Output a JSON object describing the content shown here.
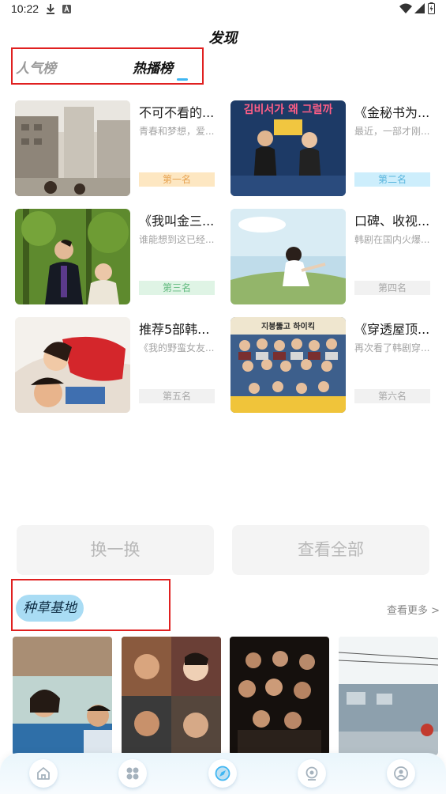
{
  "status_bar": {
    "time": "10:22"
  },
  "header": {
    "title": "发现"
  },
  "tabs": [
    {
      "label": "人气榜",
      "active": false
    },
    {
      "label": "热播榜",
      "active": true
    }
  ],
  "ranking": [
    {
      "title": "不可不看的...",
      "desc": "青春和梦想，爱...",
      "badge": "第一名"
    },
    {
      "title": "《金秘书为...",
      "desc": "最近，一部才刚...",
      "badge": "第二名"
    },
    {
      "title": "《我叫金三...",
      "desc": "谁能想到这已经...",
      "badge": "第三名"
    },
    {
      "title": "口碑、收视...",
      "desc": "韩剧在国内火爆...",
      "badge": "第四名"
    },
    {
      "title": "推荐5部韩...",
      "desc": "《我的野蛮女友...",
      "badge": "第五名"
    },
    {
      "title": "《穿透屋顶...",
      "desc": "再次看了韩剧穿...",
      "badge": "第六名"
    }
  ],
  "poster_texts": {
    "kdrama": "김비서가 왜 그럴까",
    "family": "지붕뚫고 하이킥"
  },
  "actions": {
    "refresh": "换一换",
    "view_all": "查看全部"
  },
  "section": {
    "title": "种草基地",
    "more": "查看更多 >"
  },
  "bottom_nav": [
    {
      "icon": "home-icon"
    },
    {
      "icon": "category-icon"
    },
    {
      "icon": "discover-icon"
    },
    {
      "icon": "video-icon"
    },
    {
      "icon": "profile-icon"
    }
  ],
  "colors": {
    "accent": "#3fb6f2",
    "highlight_box": "#e02020",
    "pill": "#a9dcf4"
  }
}
